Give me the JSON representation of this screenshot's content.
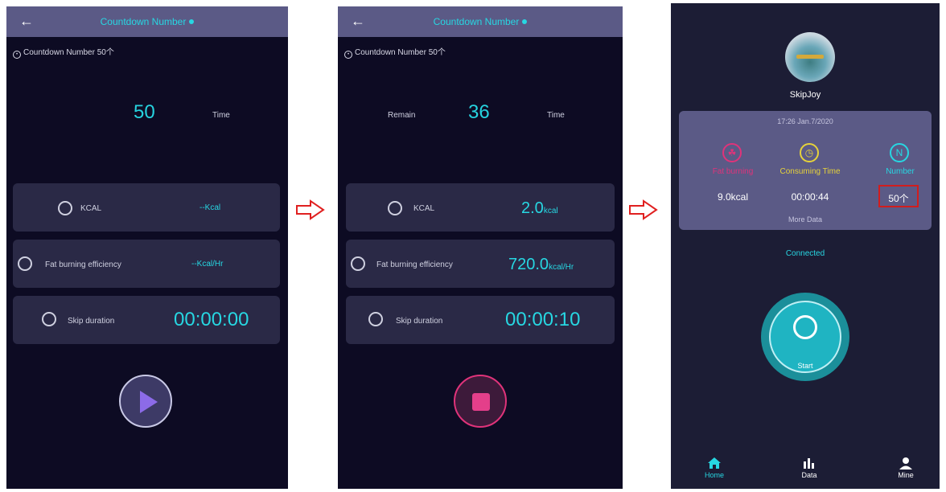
{
  "screen1": {
    "back_icon": "arrow-left-icon",
    "title": "Countdown Number",
    "subhead": "Countdown Number 50个",
    "big_number": "50",
    "time_label": "Time",
    "kcal_label": "KCAL",
    "kcal_value": "--Kcal",
    "fat_label": "Fat burning efficiency",
    "fat_value": "--Kcal/Hr",
    "skip_label": "Skip duration",
    "skip_value": "00:00:00",
    "play_icon": "play-icon"
  },
  "screen2": {
    "back_icon": "arrow-left-icon",
    "title": "Countdown Number",
    "subhead": "Countdown Number 50个",
    "remain_label": "Remain",
    "big_number": "36",
    "time_label": "Time",
    "kcal_label": "KCAL",
    "kcal_value": "2.0",
    "kcal_unit": "kcal",
    "fat_label": "Fat burning efficiency",
    "fat_value": "720.0",
    "fat_unit": "kcal/Hr",
    "skip_label": "Skip duration",
    "skip_value": "00:00:10",
    "stop_icon": "stop-icon"
  },
  "screen3": {
    "username": "SkipJoy",
    "timestamp": "17:26 Jan.7/2020",
    "stats": [
      {
        "label": "Fat burning",
        "value": "9.0kcal",
        "icon": "flame-icon",
        "color": "#e0337a"
      },
      {
        "label": "Consuming Time",
        "value": "00:00:44",
        "icon": "clock-icon",
        "color": "#e6d23a"
      },
      {
        "label": "Number",
        "value": "50个",
        "icon": "number-icon",
        "color": "#27d7e2"
      }
    ],
    "number_icon_letter": "N",
    "more_data": "More Data",
    "connected": "Connected",
    "start_label": "Start",
    "tabs": [
      {
        "label": "Home",
        "icon": "home-icon",
        "active": true
      },
      {
        "label": "Data",
        "icon": "bar-chart-icon",
        "active": false
      },
      {
        "label": "Mine",
        "icon": "user-icon",
        "active": false
      }
    ]
  },
  "colors": {
    "accent": "#27d7e2",
    "background": "#0d0b23",
    "header": "#5b5a86",
    "highlight": "#d21d1d"
  }
}
